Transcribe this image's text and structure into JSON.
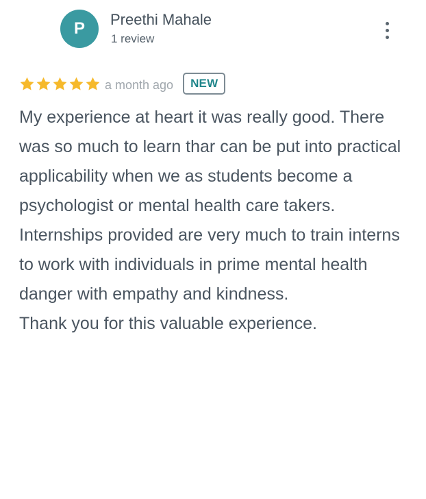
{
  "reviewer": {
    "initial": "P",
    "name": "Preethi Mahale",
    "review_count": "1 review",
    "avatar_color": "#3a9aa1"
  },
  "review": {
    "stars": 5,
    "max_stars": 5,
    "star_color": "#f6b92b",
    "date": "a month ago",
    "badge": "NEW",
    "text": "My experience at heart it was really good. There was so much to learn thar can be put into practical applicability when we as students become a psychologist or mental health care takers. Internships provided are very much to train interns to work with individuals in prime mental health danger with empathy and kindness.\nThank you for this valuable experience."
  },
  "icons": {
    "menu": "more-vert-icon",
    "star": "star-icon"
  }
}
